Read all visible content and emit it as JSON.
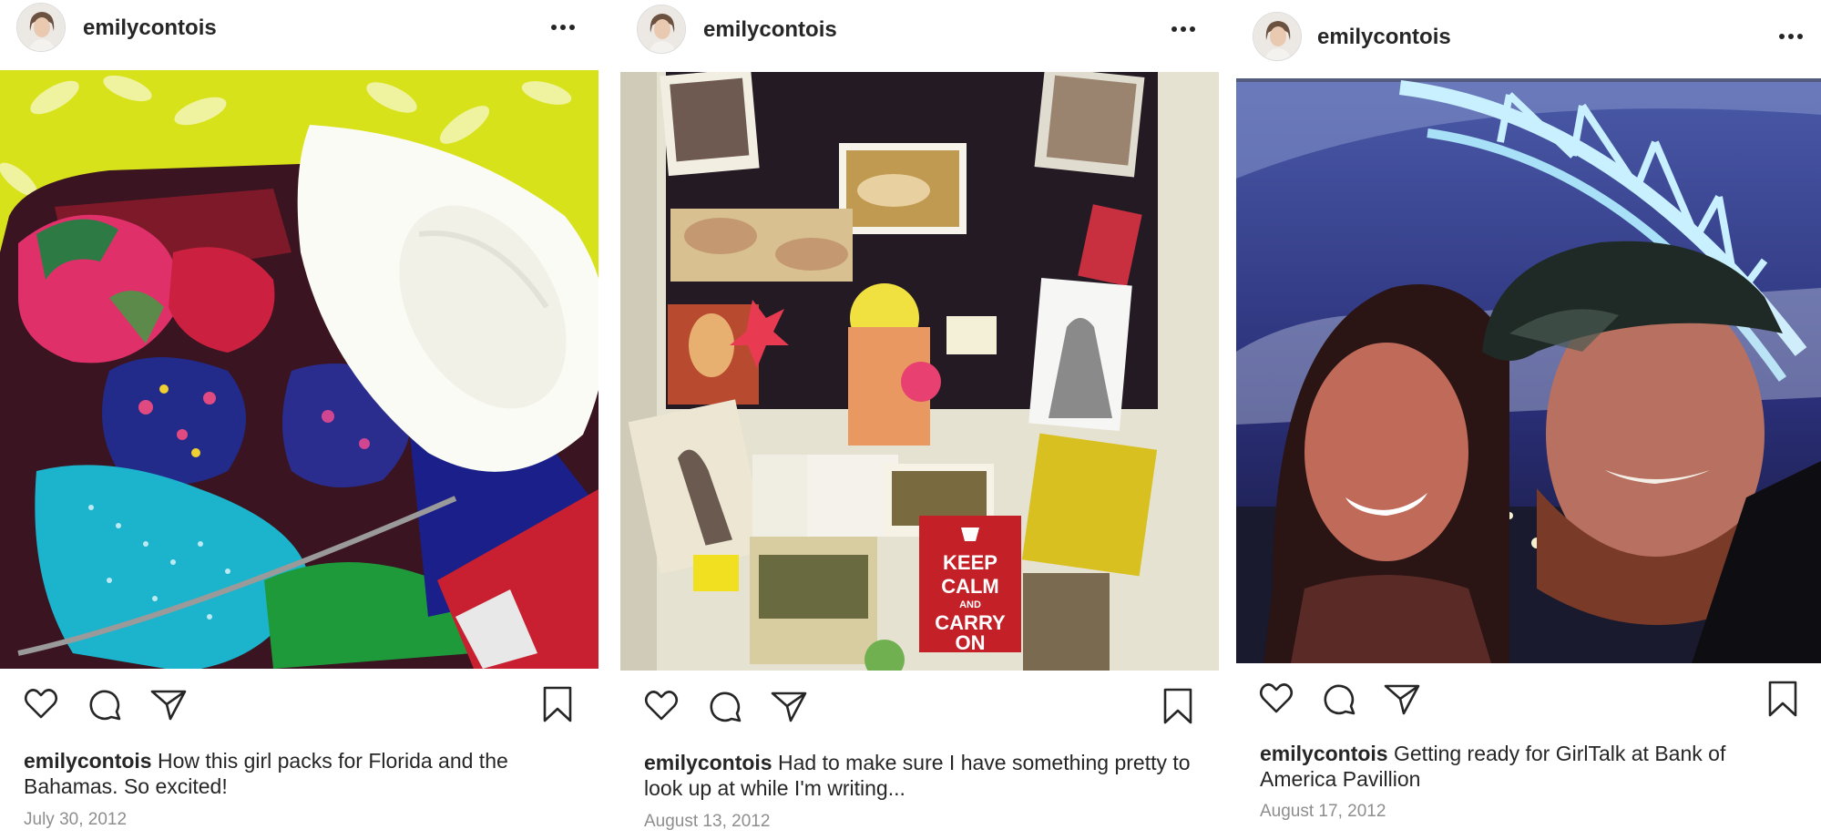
{
  "posts": [
    {
      "username": "emilycontois",
      "caption_user": "emilycontois",
      "caption_text": "How this girl packs for Florida and the Bahamas. So excited!",
      "date": "July 30, 2012",
      "photo_subject": "suitcase with bikinis and white sun hat",
      "icons": [
        "heart-icon",
        "comment-icon",
        "share-icon",
        "bookmark-icon",
        "more-options-icon"
      ]
    },
    {
      "username": "emilycontois",
      "caption_user": "emilycontois",
      "caption_text": "Had to make sure I have something pretty to look up at while I'm writing...",
      "date": "August 13, 2012",
      "photo_subject": "bulletin board with postcards and Keep Calm poster",
      "poster_text": [
        "KEEP",
        "CALM",
        "AND",
        "CARRY",
        "ON"
      ],
      "icons": [
        "heart-icon",
        "comment-icon",
        "share-icon",
        "bookmark-icon",
        "more-options-icon"
      ]
    },
    {
      "username": "emilycontois",
      "caption_user": "emilycontois",
      "caption_text": "Getting ready for GirlTalk at Bank of America Pavillion",
      "date": "August 17, 2012",
      "photo_subject": "selfie of couple under pavilion tent",
      "icons": [
        "heart-icon",
        "comment-icon",
        "share-icon",
        "bookmark-icon",
        "more-options-icon"
      ]
    }
  ],
  "colors": {
    "text": "#262626",
    "secondary": "#8e8e8e",
    "border": "#dbdbdb"
  }
}
